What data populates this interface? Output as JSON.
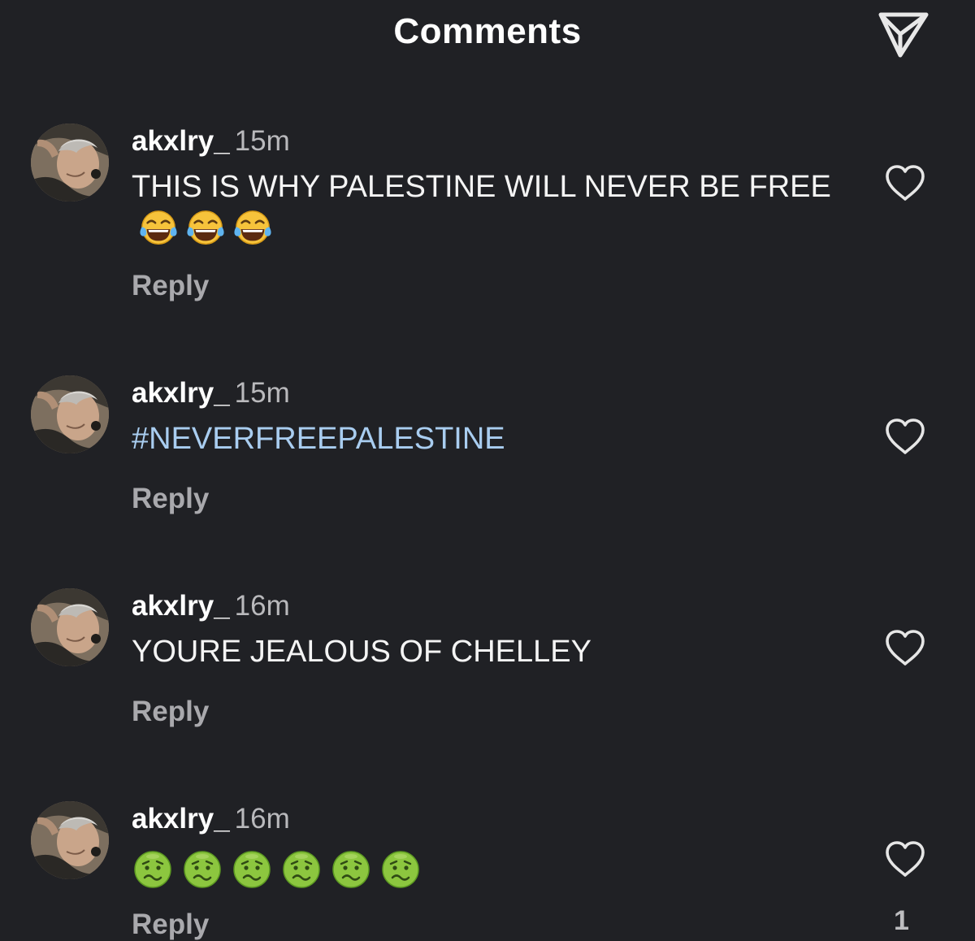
{
  "header": {
    "title": "Comments",
    "share_icon": "send-icon"
  },
  "comments": [
    {
      "username": "akxlry_",
      "time": "15m",
      "text": "THIS IS WHY PALESTINE WILL NEVER BE FREE",
      "emojis": [
        "face-with-tears-of-joy",
        "face-with-tears-of-joy",
        "face-with-tears-of-joy"
      ],
      "reply_label": "Reply"
    },
    {
      "username": "akxlry_",
      "time": "15m",
      "text": "#NEVERFREEPALESTINE",
      "reply_label": "Reply"
    },
    {
      "username": "akxlry_",
      "time": "16m",
      "text": "YOURE JEALOUS OF CHELLEY",
      "reply_label": "Reply"
    },
    {
      "username": "akxlry_",
      "time": "16m",
      "emojis": [
        "nauseated-face",
        "nauseated-face",
        "nauseated-face",
        "nauseated-face",
        "nauseated-face",
        "nauseated-face"
      ],
      "reply_label": "Reply",
      "like_count": "1"
    }
  ],
  "colors": {
    "background": "#202125",
    "hashtag": "#a9cdf0",
    "secondary_text": "#a9a9ad"
  }
}
